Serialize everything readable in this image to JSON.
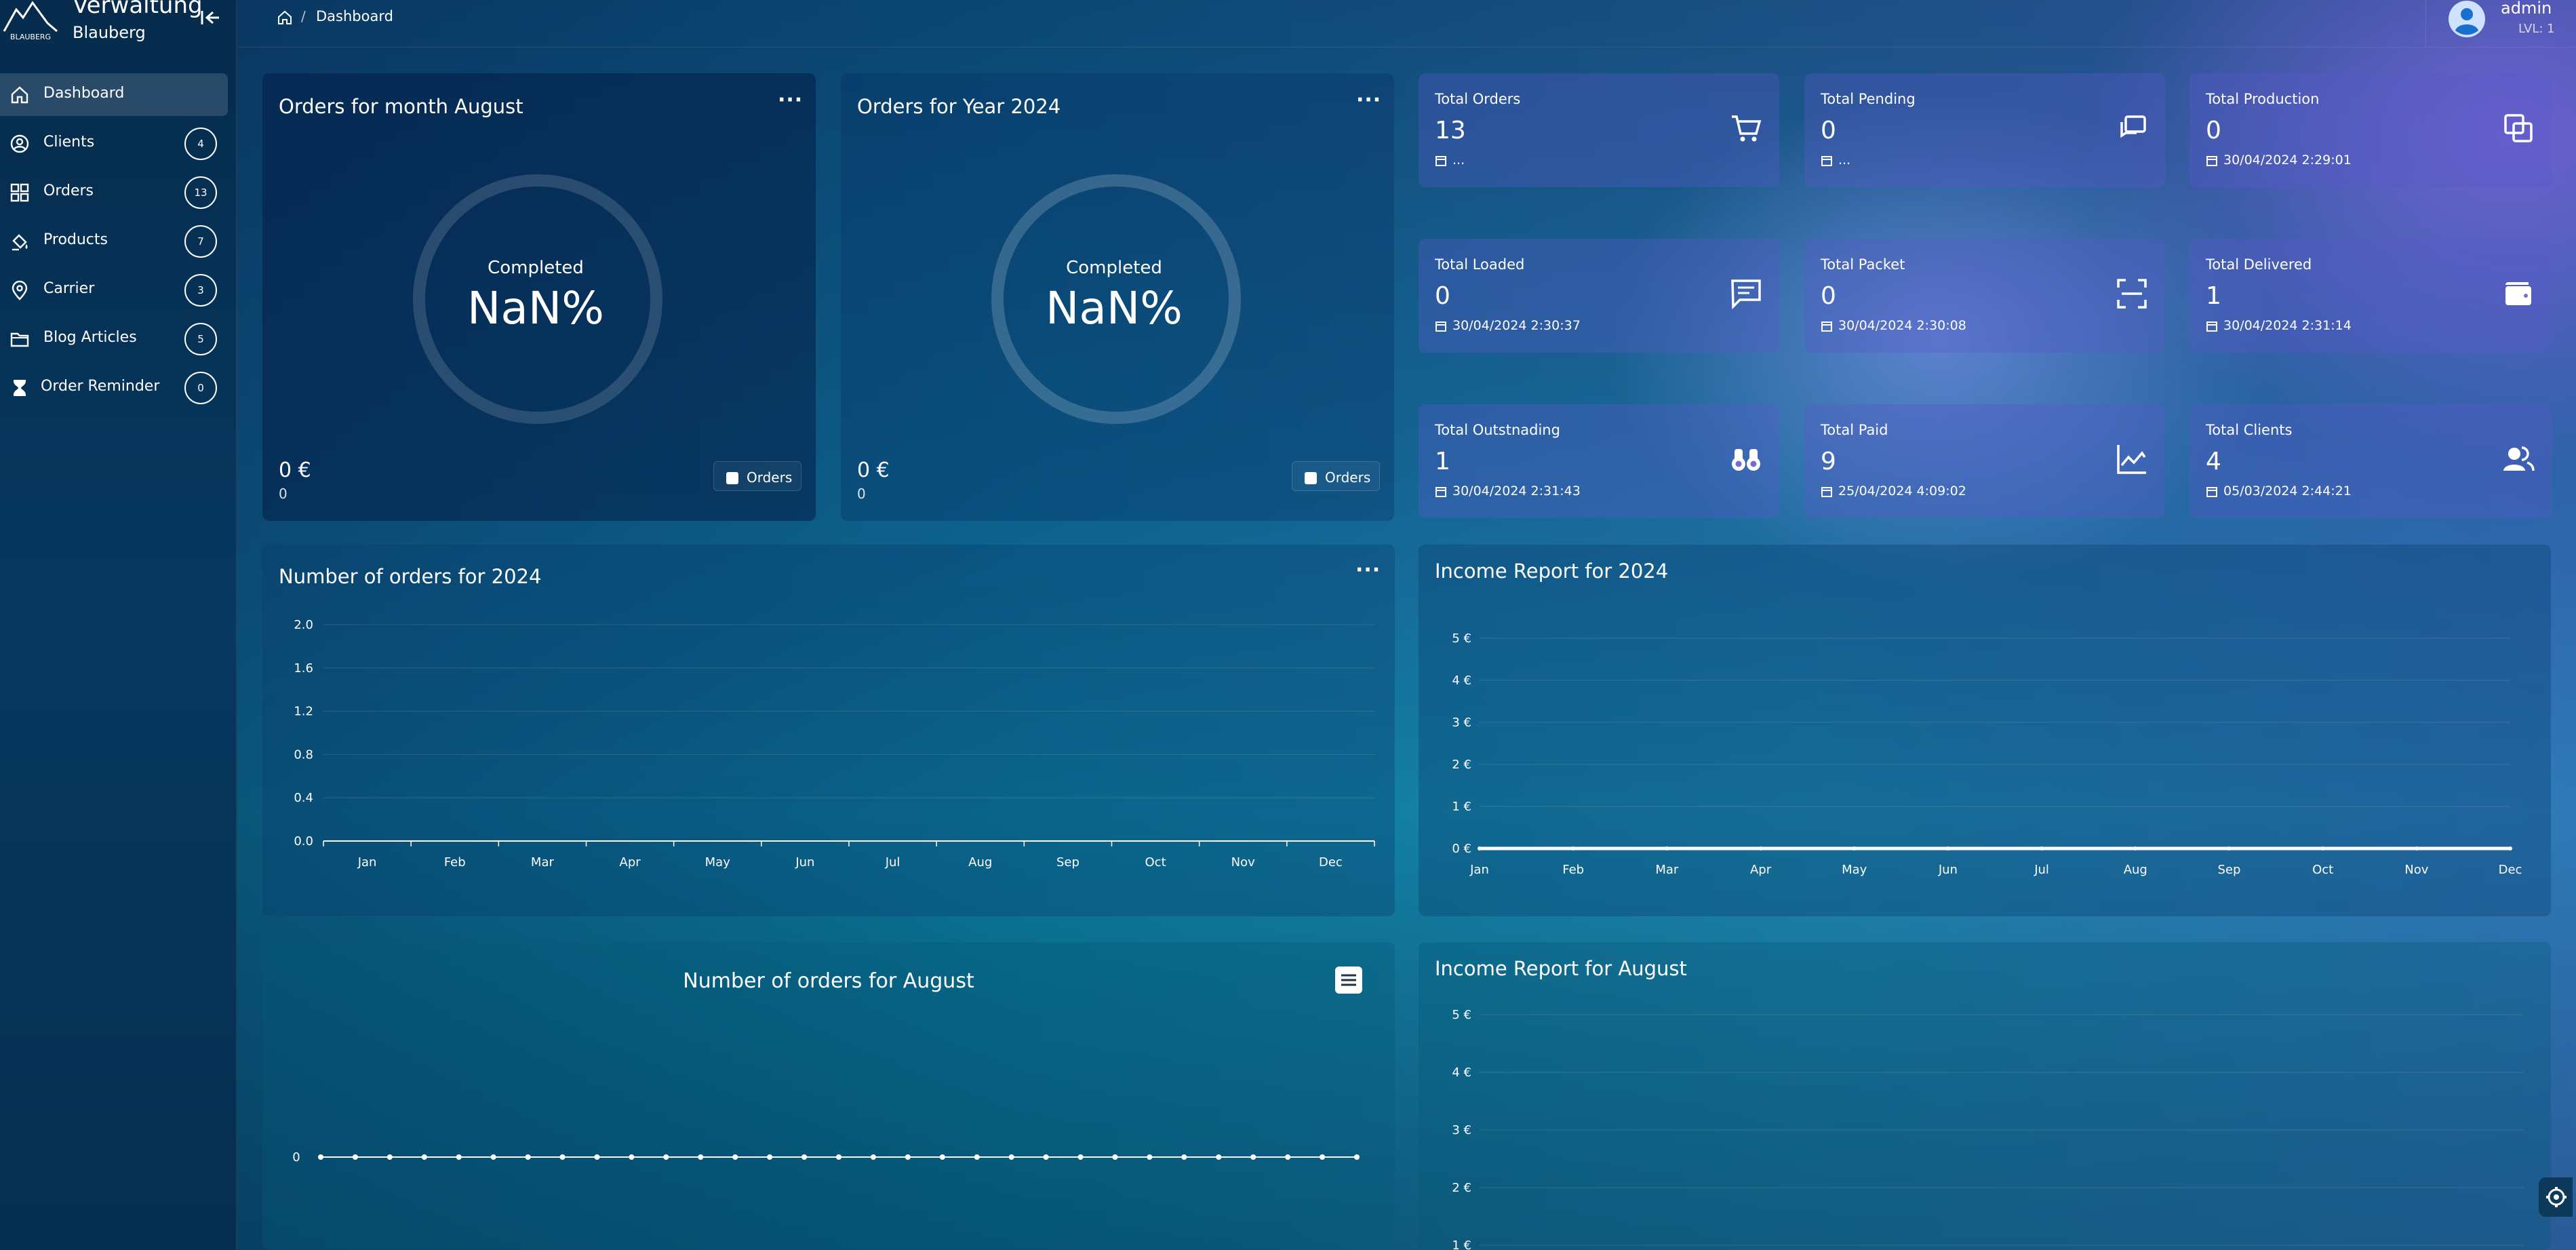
{
  "brand": {
    "title": "Verwaltung",
    "subtitle": "Blauberg",
    "logo_text": "BLAUBERG"
  },
  "breadcrumb": {
    "current": "Dashboard",
    "separator": "/"
  },
  "user": {
    "name": "admin",
    "level": "LVL: 1"
  },
  "sidebar": {
    "items": [
      {
        "label": "Dashboard",
        "icon": "home-icon",
        "badge": ""
      },
      {
        "label": "Clients",
        "icon": "user-circle-icon",
        "badge": "4"
      },
      {
        "label": "Orders",
        "icon": "grid-icon",
        "badge": "13"
      },
      {
        "label": "Products",
        "icon": "paint-bucket-icon",
        "badge": "7"
      },
      {
        "label": "Carrier",
        "icon": "map-pin-icon",
        "badge": "3"
      },
      {
        "label": "Blog Articles",
        "icon": "folder-icon",
        "badge": "5"
      },
      {
        "label": "Order Reminder",
        "icon": "hourglass-icon",
        "badge": "0"
      }
    ]
  },
  "donuts": [
    {
      "title": "Orders for month August",
      "center_label": "Completed",
      "center_value": "NaN%",
      "amount": "0 €",
      "amount_sub": "0",
      "legend": "Orders"
    },
    {
      "title": "Orders for Year 2024",
      "center_label": "Completed",
      "center_value": "NaN%",
      "amount": "0 €",
      "amount_sub": "0",
      "legend": "Orders"
    }
  ],
  "stats": [
    {
      "label": "Total Orders",
      "value": "13",
      "footer": "...",
      "icon": "cart-icon"
    },
    {
      "label": "Total Pending",
      "value": "0",
      "footer": "...",
      "icon": "chat-bubbles-icon"
    },
    {
      "label": "Total Production",
      "value": "0",
      "footer": "30/04/2024 2:29:01",
      "icon": "layers-icon"
    },
    {
      "label": "Total Loaded",
      "value": "0",
      "footer": "30/04/2024 2:30:37",
      "icon": "message-icon"
    },
    {
      "label": "Total Packet",
      "value": "0",
      "footer": "30/04/2024 2:30:08",
      "icon": "scan-icon"
    },
    {
      "label": "Total Delivered",
      "value": "1",
      "footer": "30/04/2024 2:31:14",
      "icon": "wallet-icon"
    },
    {
      "label": "Total Outstnading",
      "value": "1",
      "footer": "30/04/2024 2:31:43",
      "icon": "binoculars-icon"
    },
    {
      "label": "Total Paid",
      "value": "9",
      "footer": "25/04/2024 4:09:02",
      "icon": "line-chart-icon"
    },
    {
      "label": "Total Clients",
      "value": "4",
      "footer": "05/03/2024 2:44:21",
      "icon": "users-icon"
    }
  ],
  "panels": {
    "orders_year_title": "Number of orders for 2024",
    "income_year_title": "Income Report for 2024",
    "orders_month_title": "Number of orders for August",
    "income_month_title": "Income Report for August"
  },
  "chart_data": [
    {
      "type": "line",
      "title": "Number of orders for 2024",
      "categories": [
        "Jan",
        "Feb",
        "Mar",
        "Apr",
        "May",
        "Jun",
        "Jul",
        "Aug",
        "Sep",
        "Oct",
        "Nov",
        "Dec"
      ],
      "y_ticks": [
        "0.0",
        "0.4",
        "0.8",
        "1.2",
        "1.6",
        "2.0"
      ],
      "ylim": [
        0,
        2
      ],
      "values": [],
      "grid": true
    },
    {
      "type": "line",
      "title": "Income Report for 2024",
      "categories": [
        "Jan",
        "Feb",
        "Mar",
        "Apr",
        "May",
        "Jun",
        "Jul",
        "Aug",
        "Sep",
        "Oct",
        "Nov",
        "Dec"
      ],
      "y_ticks": [
        "0 €",
        "1 €",
        "2 €",
        "3 €",
        "4 €",
        "5 €"
      ],
      "ylim": [
        0,
        5
      ],
      "values": [
        0,
        0,
        0,
        0,
        0,
        0,
        0,
        0,
        0,
        0,
        0,
        0
      ],
      "grid": true
    },
    {
      "type": "line",
      "title": "Number of orders for August",
      "y_ticks": [
        "0"
      ],
      "values": [
        0,
        0,
        0,
        0,
        0,
        0,
        0,
        0,
        0,
        0,
        0,
        0,
        0,
        0,
        0,
        0,
        0,
        0,
        0,
        0,
        0,
        0,
        0,
        0,
        0,
        0,
        0,
        0,
        0,
        0,
        0
      ],
      "grid": false
    },
    {
      "type": "line",
      "title": "Income Report for August",
      "y_ticks": [
        "1 €",
        "2 €",
        "3 €",
        "4 €",
        "5 €"
      ],
      "ylim": [
        1,
        5
      ],
      "values": [],
      "grid": true
    }
  ]
}
